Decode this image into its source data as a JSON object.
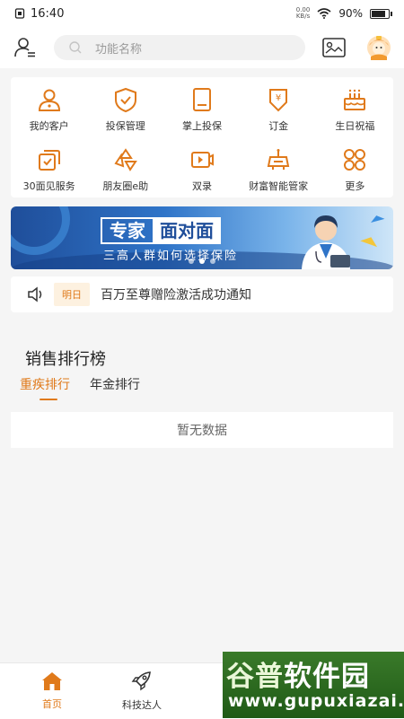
{
  "status_bar": {
    "time": "16:40",
    "net_speed_value": "0.00",
    "net_speed_unit": "KB/s",
    "battery_text": "90%",
    "battery_level": 0.9
  },
  "top_bar": {
    "search_placeholder": "功能名称"
  },
  "grid": {
    "accent_color": "#e07a1b",
    "items": [
      {
        "label": "我的客户",
        "icon": "person-icon"
      },
      {
        "label": "投保管理",
        "icon": "shield-check-icon"
      },
      {
        "label": "掌上投保",
        "icon": "tablet-icon"
      },
      {
        "label": "订金",
        "icon": "yen-icon"
      },
      {
        "label": "生日祝福",
        "icon": "birthday-cake-icon"
      },
      {
        "label": "30面见服务",
        "icon": "meeting-icon"
      },
      {
        "label": "朋友圈e助",
        "icon": "camera-aperture-icon"
      },
      {
        "label": "双录",
        "icon": "video-icon"
      },
      {
        "label": "财富智能管家",
        "icon": "robot-icon"
      },
      {
        "label": "更多",
        "icon": "more-grid-icon"
      }
    ]
  },
  "banner": {
    "title_part1": "专家",
    "title_part2": "面对面",
    "subtitle": "三高人群如何选择保险"
  },
  "notice": {
    "tag": "明日",
    "text": "百万至尊赠险激活成功通知"
  },
  "ranking": {
    "title": "销售排行榜",
    "tabs": [
      {
        "label": "重疾排行"
      },
      {
        "label": "年金排行"
      }
    ],
    "empty_text": "暂无数据"
  },
  "bottom_nav": {
    "items": [
      {
        "label": "首页",
        "icon": "home-icon"
      },
      {
        "label": "科技达人",
        "icon": "rocket-icon"
      }
    ]
  },
  "watermark": {
    "line1_a": "谷普",
    "line1_b": "软件园",
    "line2": "www.gupuxiazai.com"
  }
}
